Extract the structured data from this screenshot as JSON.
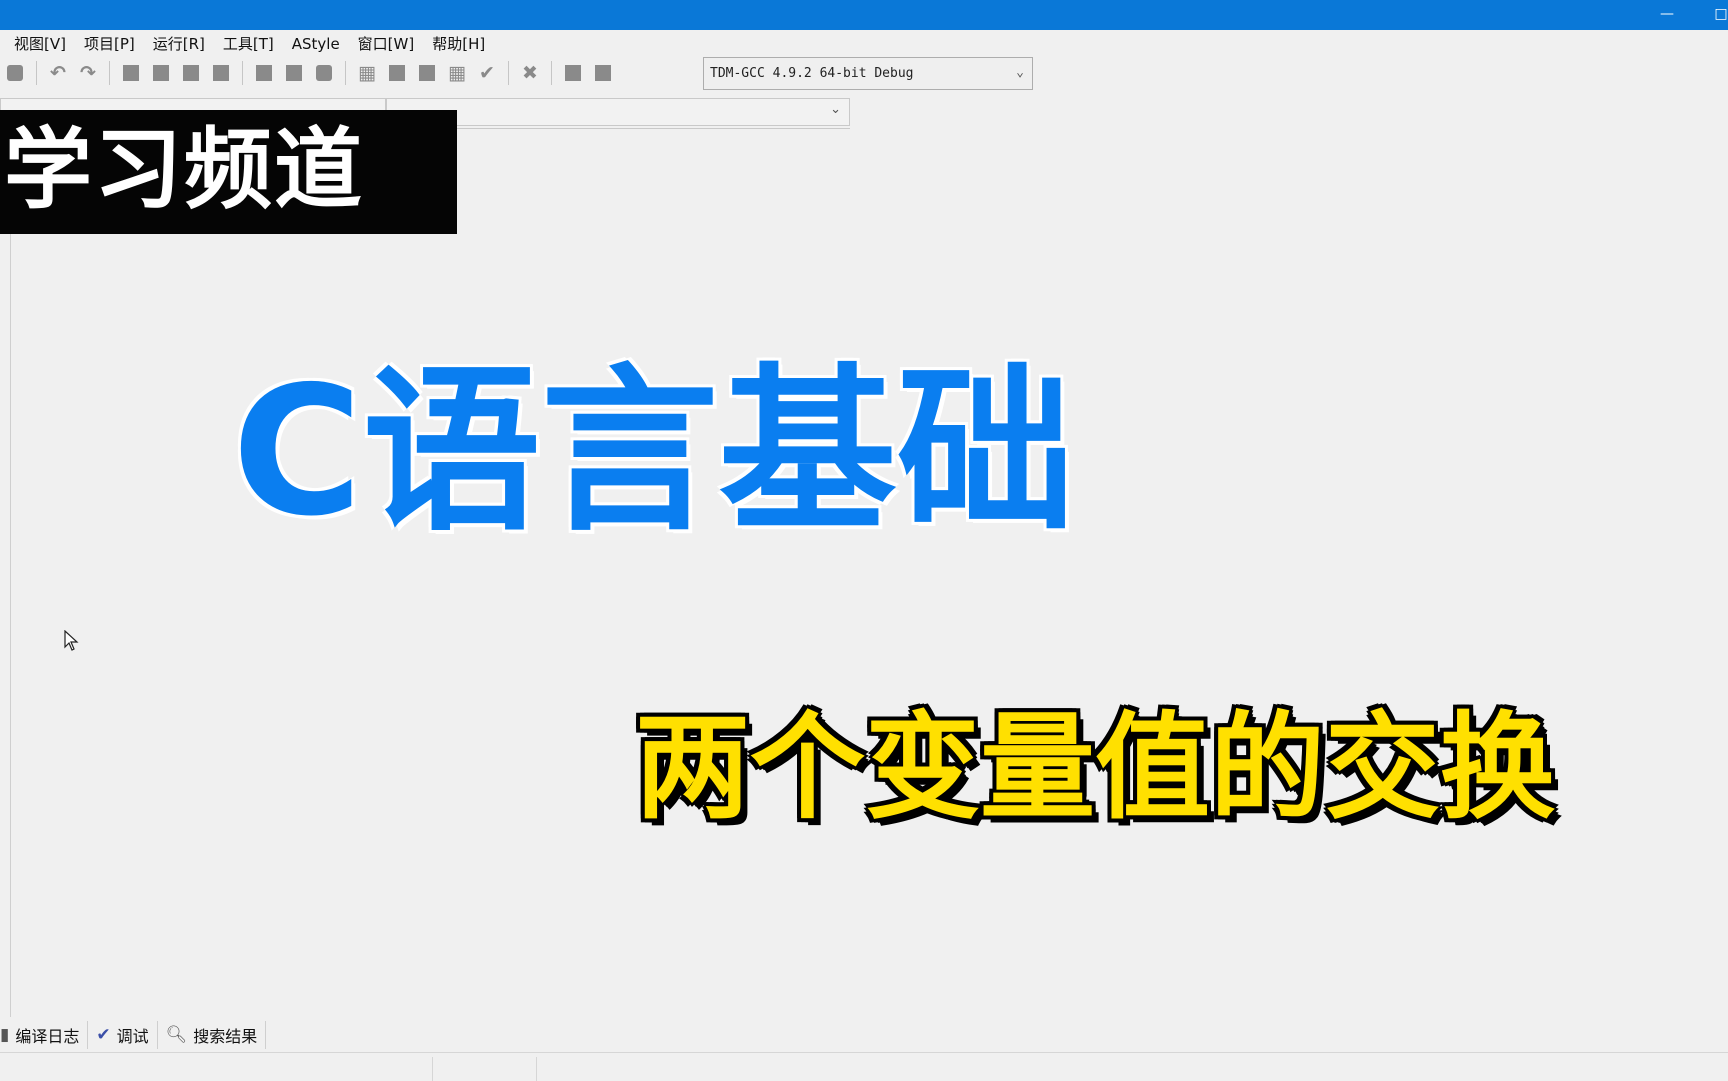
{
  "window": {
    "minimize_glyph": "—",
    "maximize_glyph": "□"
  },
  "menubar": {
    "items": [
      "视图[V]",
      "项目[P]",
      "运行[R]",
      "工具[T]",
      "AStyle",
      "窗口[W]",
      "帮助[H]"
    ]
  },
  "toolbar": {
    "compiler_selected": "TDM-GCC 4.9.2 64-bit Debug"
  },
  "overlay": {
    "badge_text": "学习频道",
    "main_title": "C语言基础",
    "subtitle": "两个变量值的交换",
    "colors": {
      "main_title": "#0a7ef0",
      "subtitle": "#ffe000",
      "badge_bg": "#050505"
    }
  },
  "bottom_tabs": [
    {
      "label": "编译日志",
      "icon": "compile-log-icon"
    },
    {
      "label": "调试",
      "icon": "debug-check-icon"
    },
    {
      "label": "搜索结果",
      "icon": "search-results-icon"
    }
  ],
  "colors": {
    "titlebar": "#0a78d7",
    "background": "#f0f0f0"
  }
}
